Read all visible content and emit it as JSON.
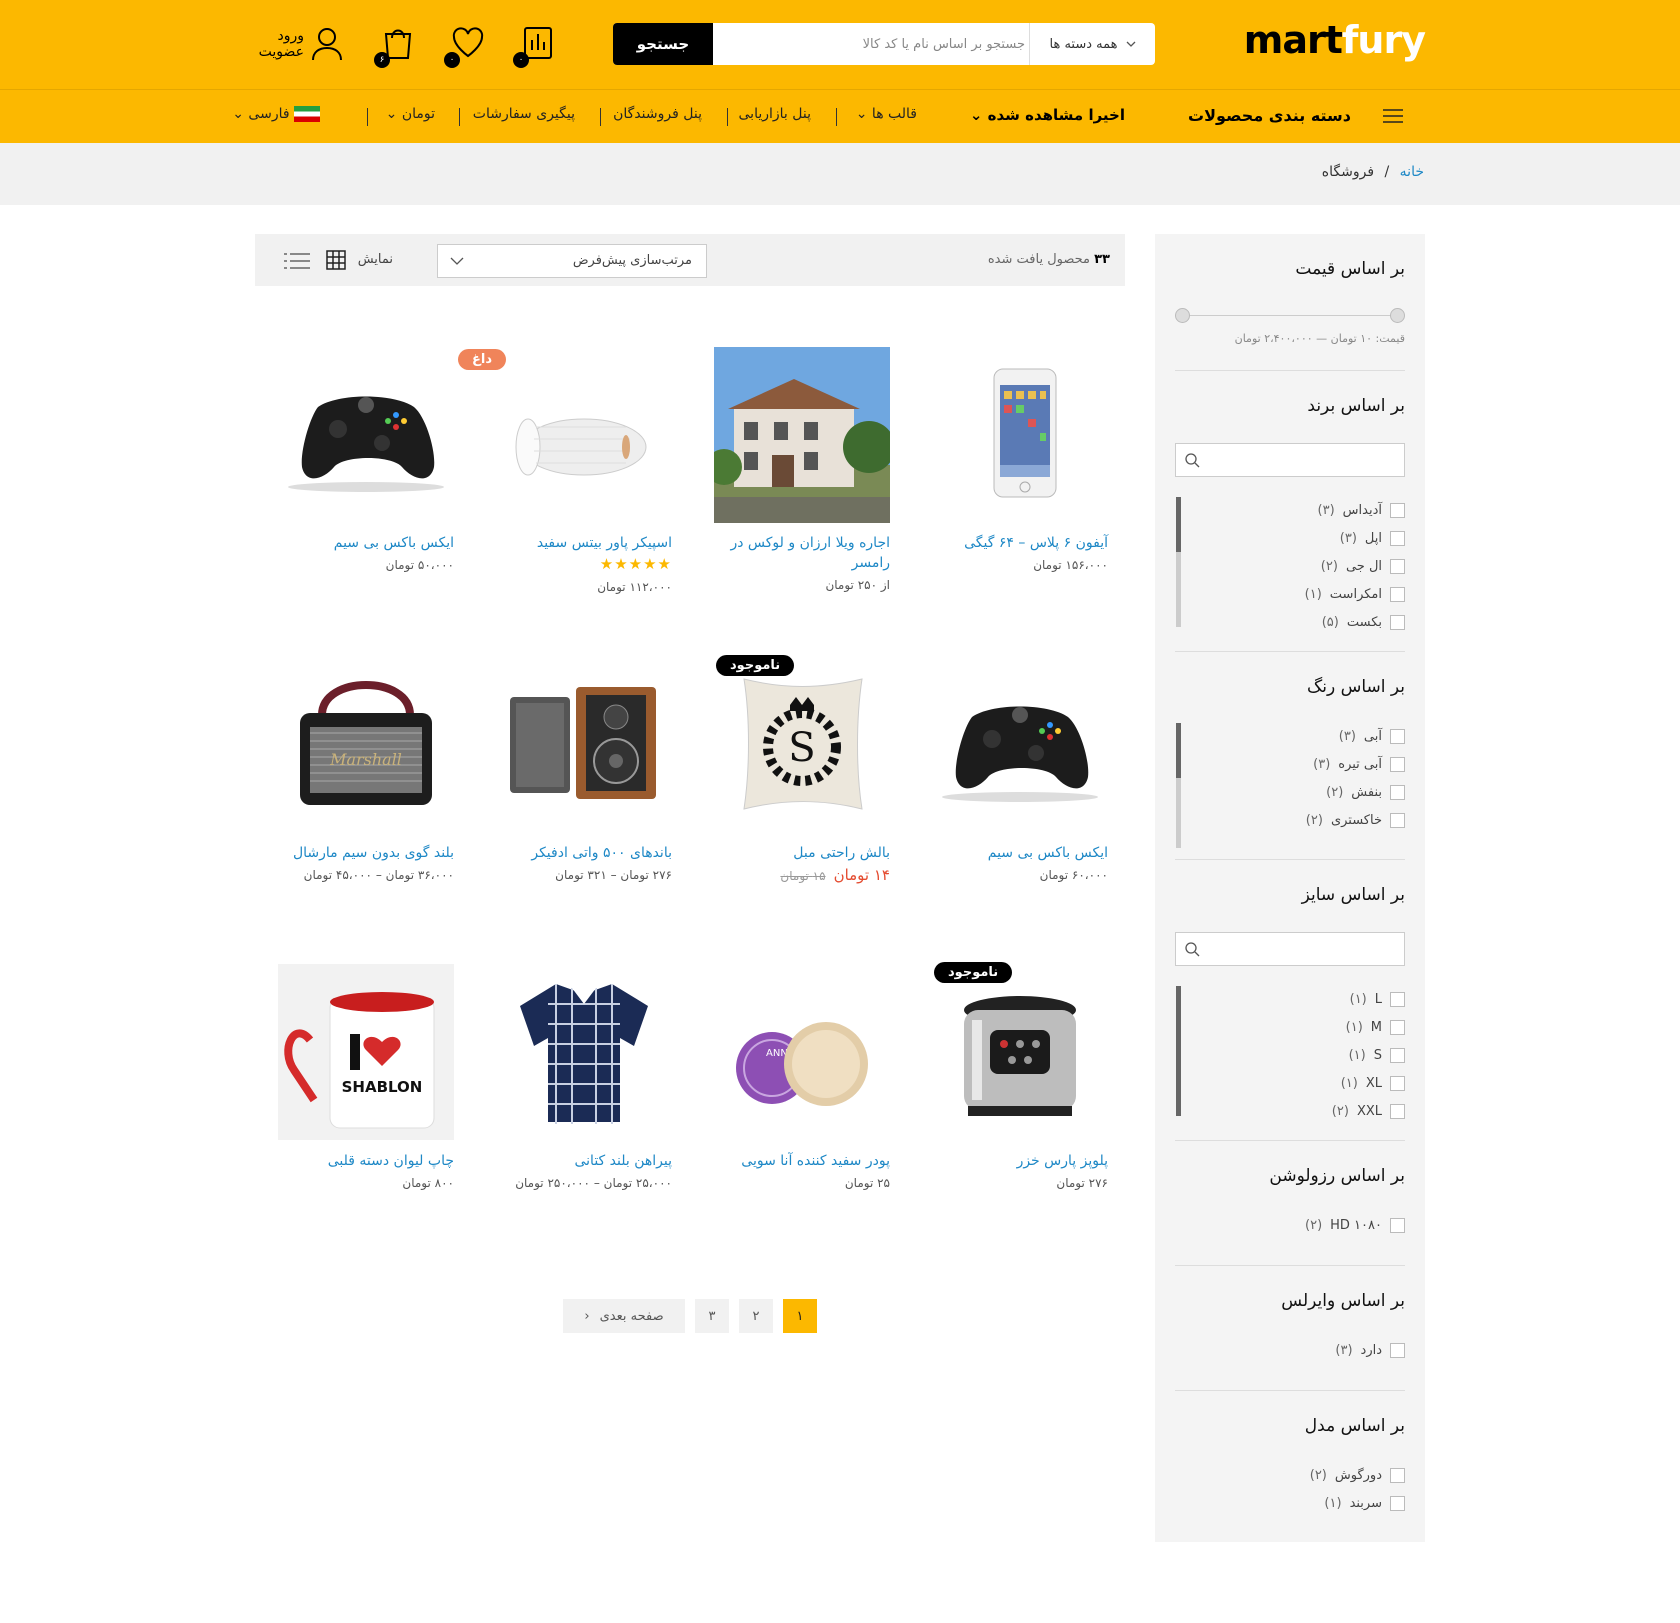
{
  "header": {
    "logo_dark": "mart",
    "logo_light": "fury",
    "search_button": "جستجو",
    "search_placeholder": "جستجو بر اساس نام یا کد کالا",
    "category_select": "همه دسته ها",
    "compare_count": "۰",
    "wishlist_count": "۰",
    "cart_count": "۶",
    "login": "ورود",
    "register": "عضویت"
  },
  "nav": {
    "categories": "دسته بندی محصولات",
    "recent": "اخیرا مشاهده شده",
    "items": [
      "قالب ها",
      "پنل بازاریابی",
      "پنل فروشندگان",
      "پیگیری سفارشات",
      "تومان",
      "فارسی"
    ]
  },
  "breadcrumb": {
    "home": "خانه",
    "separator": "/",
    "current": "فروشگاه"
  },
  "toolbar": {
    "count": "۳۳",
    "count_text": "محصول یافت شده",
    "sort": "مرتب‌سازی پیش‌فرض",
    "view_label": "نمایش"
  },
  "sidebar": {
    "price": {
      "title": "بر اساس قیمت",
      "range_text": "قیمت: ۱۰ تومان — ۲،۴۰۰،۰۰۰ تومان"
    },
    "brand": {
      "title": "بر اساس برند",
      "items": [
        "آدیداس",
        "اپل",
        "ال جی",
        "امکراست",
        "بکست"
      ],
      "counts": [
        "(۳)",
        "(۳)",
        "(۲)",
        "(۱)",
        "(۵)"
      ]
    },
    "color": {
      "title": "بر اساس رنگ",
      "items": [
        "آبی",
        "آبی تیره",
        "بنفش",
        "خاکستری"
      ],
      "counts": [
        "(۳)",
        "(۳)",
        "(۲)",
        "(۲)"
      ]
    },
    "size": {
      "title": "بر اساس سایز",
      "items": [
        "L",
        "M",
        "S",
        "XL",
        "XXL"
      ],
      "counts": [
        "(۱)",
        "(۱)",
        "(۱)",
        "(۱)",
        "(۲)"
      ]
    },
    "resolution": {
      "title": "بر اساس رزولوشن",
      "items": [
        "HD ۱۰۸۰"
      ],
      "counts": [
        "(۲)"
      ]
    },
    "wireless": {
      "title": "بر اساس وایرلس",
      "items": [
        "دارد"
      ],
      "counts": [
        "(۳)"
      ]
    },
    "model": {
      "title": "بر اساس مدل",
      "items": [
        "دورگوش",
        "سربند"
      ],
      "counts": [
        "(۲)",
        "(۱)"
      ]
    }
  },
  "products": [
    {
      "title": "آیفون ۶ پلاس – ۶۴ گیگی",
      "price": "۱۵۶،۰۰۰ تومان"
    },
    {
      "title": "اجاره ویلا ارزان و لوکس در رامسر",
      "price": "از ۲۵۰ تومان"
    },
    {
      "title": "اسپیکر پاور بیتس سفید",
      "price": "۱۱۲،۰۰۰ تومان",
      "tag": "داغ",
      "rating": 5
    },
    {
      "title": "ایکس باکس بی سیم",
      "price": "۵۰،۰۰۰ تومان"
    },
    {
      "title": "ایکس باکس بی سیم",
      "price": "۶۰،۰۰۰ تومان"
    },
    {
      "title": "بالش راحتی مبل",
      "price_old": "۱۵ تومان",
      "price_new": "۱۴ تومان",
      "tag": "ناموجود"
    },
    {
      "title": "باندهای ۵۰۰ واتی ادفیکر",
      "price": "۲۷۶ تومان – ۳۲۱ تومان"
    },
    {
      "title": "بلند گوی بدون سیم مارشال",
      "price": "۳۶،۰۰۰ تومان – ۴۵،۰۰۰ تومان"
    },
    {
      "title": "پلوپز پارس خزر",
      "price": "۲۷۶ تومان",
      "tag": "ناموجود"
    },
    {
      "title": "پودر سفید کننده آنا سویی",
      "price": "۲۵ تومان"
    },
    {
      "title": "پیراهن بلند کتانی",
      "price": "۲۵،۰۰۰ تومان – ۲۵۰،۰۰۰ تومان"
    },
    {
      "title": "چاپ لیوان دسته قلبی",
      "price": "۸۰۰ تومان"
    }
  ],
  "pagination": {
    "pages": [
      "۱",
      "۲",
      "۳"
    ],
    "next": "صفحه بعدی"
  },
  "colors": {
    "accent": "#fcb800",
    "link": "#1e88c6",
    "hot": "#f0845a",
    "sale": "#e44b2f"
  }
}
